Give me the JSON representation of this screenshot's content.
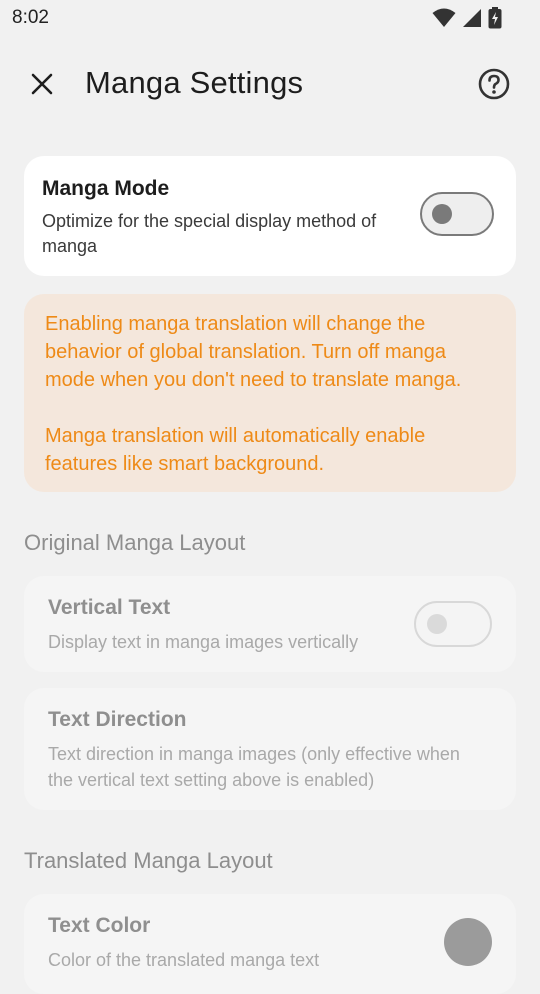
{
  "status_bar": {
    "time": "8:02",
    "icons": [
      "wifi-icon",
      "signal-icon",
      "battery-charging-icon"
    ]
  },
  "header": {
    "title": "Manga Settings",
    "close_icon": "close-icon",
    "help_icon": "help-icon"
  },
  "manga_mode": {
    "title": "Manga Mode",
    "subtitle": "Optimize for the special display method of manga",
    "enabled": false
  },
  "warning": {
    "line1": "Enabling manga translation will change the behavior of global translation. Turn off manga mode when you don't need to translate manga.",
    "line2": "Manga translation will automatically enable features like smart background.",
    "color": "#ee8a17",
    "background": "#f4e7dc"
  },
  "sections": {
    "original": {
      "header": "Original Manga Layout",
      "vertical_text": {
        "title": "Vertical Text",
        "subtitle": "Display text in manga images vertically",
        "enabled": false
      },
      "text_direction": {
        "title": "Text Direction",
        "subtitle": "Text direction in manga images (only effective when the vertical text setting above is enabled)"
      }
    },
    "translated": {
      "header": "Translated Manga Layout",
      "text_color": {
        "title": "Text Color",
        "subtitle": "Color of the translated manga text",
        "swatch_color": "#9b9b9b"
      }
    }
  }
}
